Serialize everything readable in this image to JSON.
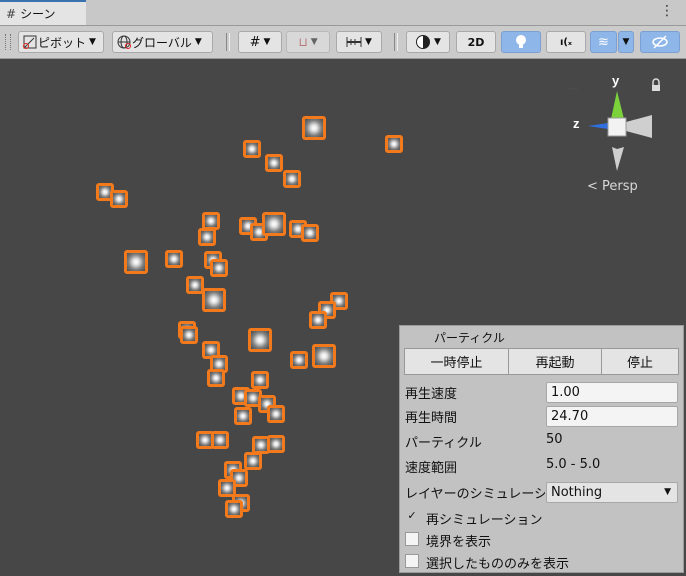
{
  "tab": {
    "icon": "grid-icon",
    "label": "シーン"
  },
  "toolbar": {
    "pivot_label": "ピボット",
    "global_label": "グローバル",
    "mode_2d_label": "2D"
  },
  "scene": {
    "camera_mode": "Persp",
    "axis_y": "y",
    "axis_z": "z"
  },
  "particle_panel": {
    "title": "パーティクル",
    "buttons": {
      "pause": "一時停止",
      "restart": "再起動",
      "stop": "停止"
    },
    "playback_speed": {
      "label": "再生速度",
      "value": "1.00"
    },
    "playback_time": {
      "label": "再生時間",
      "value": "24.70"
    },
    "particles": {
      "label": "パーティクル",
      "value": "50"
    },
    "speed_range": {
      "label": "速度範囲",
      "value": "5.0 - 5.0"
    },
    "simulate_layers": {
      "label": "レイヤーのシミュレーション",
      "label_visible": "レイヤーのシミュレーショ",
      "value": "Nothing"
    },
    "resimulation": {
      "label": "再シミュレーション",
      "checked": true
    },
    "show_bounds": {
      "label": "境界を表示",
      "checked": false
    },
    "show_only_selected": {
      "label": "選択したもののみを表示",
      "checked": false
    }
  },
  "colors": {
    "selection_outline": "#f37a1c",
    "active_button": "#8fb6e8"
  }
}
